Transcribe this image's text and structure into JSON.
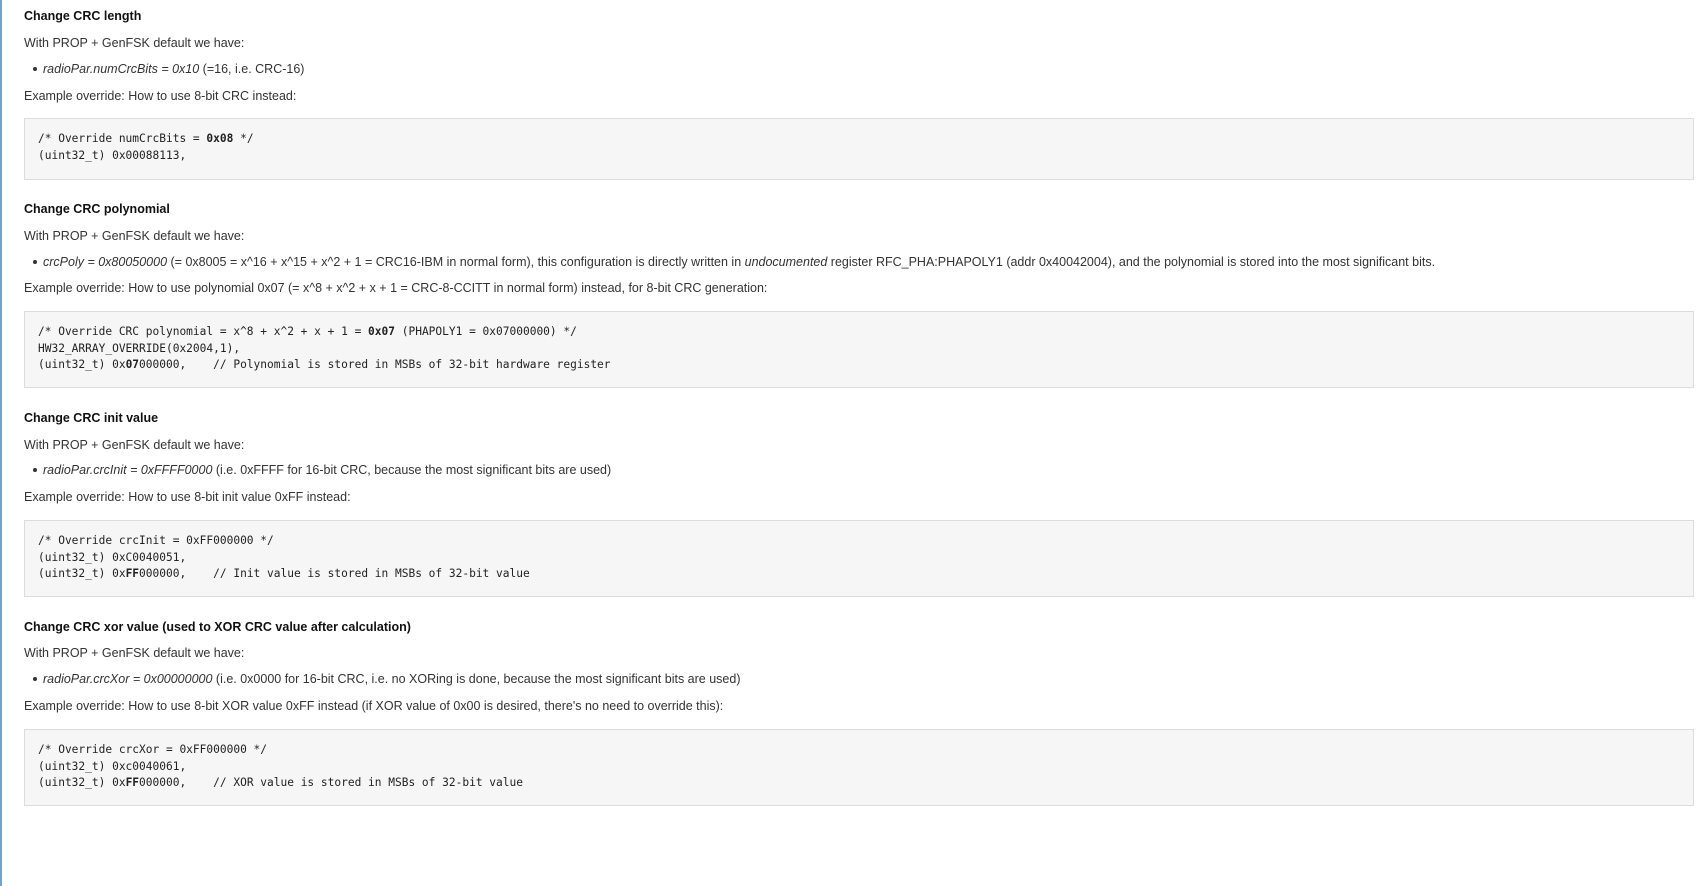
{
  "sections": [
    {
      "heading": "Change CRC length",
      "intro": "With PROP + GenFSK default we have:",
      "bullet_italic": "radioPar.numCrcBits = 0x10",
      "bullet_mid": "",
      "bullet_italic2": "",
      "bullet_rest": " (=16, i.e. CRC-16)",
      "example": "Example override: How to use 8-bit CRC instead:",
      "code": [
        {
          "pre": "/* Override numCrcBits = ",
          "bold": "0x08",
          "post": " */"
        },
        {
          "pre": "(uint32_t) 0x00088113,",
          "bold": "",
          "post": ""
        }
      ]
    },
    {
      "heading": "Change CRC polynomial",
      "intro": "With PROP + GenFSK default we have:",
      "bullet_italic": "crcPoly = 0x80050000",
      "bullet_mid": " (= 0x8005 = x^16 + x^15 + x^2 + 1 = CRC16-IBM in normal form), this configuration is directly written in ",
      "bullet_italic2": "undocumented",
      "bullet_rest": " register RFC_PHA:PHAPOLY1 (addr 0x40042004), and the polynomial is stored into the most significant bits.",
      "example": "Example override: How to use polynomial 0x07 (= x^8 + x^2 + x + 1 = CRC-8-CCITT in normal form) instead, for 8-bit CRC generation:",
      "code": [
        {
          "pre": "/* Override CRC polynomial = x^8 + x^2 + x + 1 = ",
          "bold": "0x07",
          "post": " (PHAPOLY1 = 0x07000000) */"
        },
        {
          "pre": "HW32_ARRAY_OVERRIDE(0x2004,1),",
          "bold": "",
          "post": ""
        },
        {
          "pre": "(uint32_t) 0x",
          "bold": "07",
          "post": "000000,    // Polynomial is stored in MSBs of 32-bit hardware register"
        }
      ]
    },
    {
      "heading": "Change CRC init value",
      "intro": "With PROP + GenFSK default we have:",
      "bullet_italic": "radioPar.crcInit = 0xFFFF0000",
      "bullet_mid": "",
      "bullet_italic2": "",
      "bullet_rest": " (i.e. 0xFFFF for 16-bit CRC, because the most significant bits are used)",
      "example": "Example override: How to use 8-bit init value 0xFF instead:",
      "code": [
        {
          "pre": "/* Override crcInit = 0xFF000000 */",
          "bold": "",
          "post": ""
        },
        {
          "pre": "(uint32_t) 0xC0040051,",
          "bold": "",
          "post": ""
        },
        {
          "pre": "(uint32_t) 0x",
          "bold": "FF",
          "post": "000000,    // Init value is stored in MSBs of 32-bit value"
        }
      ]
    },
    {
      "heading": "Change CRC xor value (used to XOR CRC value after calculation)",
      "intro": "With PROP + GenFSK default we have:",
      "bullet_italic": "radioPar.crcXor = 0x00000000",
      "bullet_mid": "",
      "bullet_italic2": "",
      "bullet_rest": " (i.e. 0x0000 for 16-bit CRC, i.e. no XORing is done, because the most significant bits are used)",
      "example": "Example override: How to use 8-bit XOR value 0xFF instead (if XOR value of 0x00 is desired, there's no need to override this):",
      "code": [
        {
          "pre": "/* Override crcXor = 0xFF000000 */",
          "bold": "",
          "post": ""
        },
        {
          "pre": "(uint32_t) 0xc0040061,",
          "bold": "",
          "post": ""
        },
        {
          "pre": "(uint32_t) 0x",
          "bold": "FF",
          "post": "000000,    // XOR value is stored in MSBs of 32-bit value"
        }
      ]
    }
  ]
}
